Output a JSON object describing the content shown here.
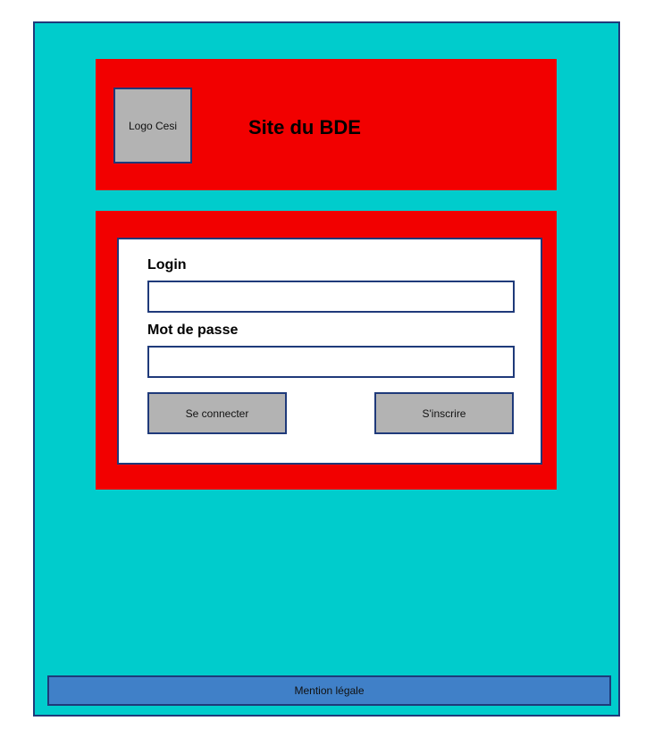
{
  "header": {
    "logo_text": "Logo Cesi",
    "title": "Site du BDE"
  },
  "login_form": {
    "login_label": "Login",
    "login_value": "",
    "password_label": "Mot de passe",
    "password_value": "",
    "connect_button": "Se connecter",
    "register_button": "S'inscrire"
  },
  "footer": {
    "legal_text": "Mention légale"
  },
  "colors": {
    "background": "#00cccc",
    "header_bg": "#f20000",
    "form_bg": "#ffffff",
    "button_bg": "#b3b3b3",
    "footer_bg": "#4080c8",
    "border": "#1f3a7a"
  }
}
